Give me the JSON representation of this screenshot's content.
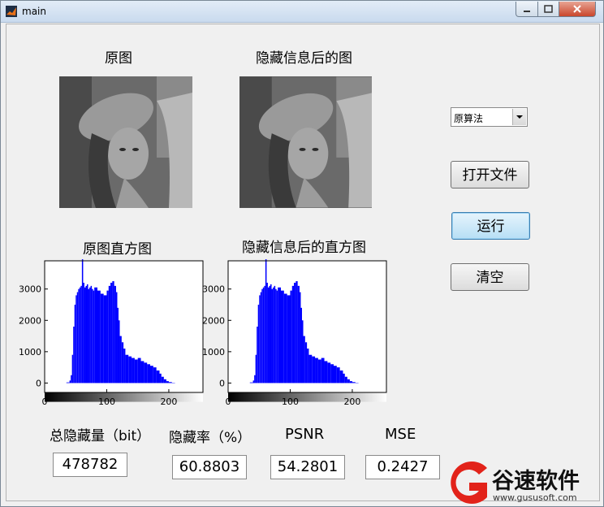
{
  "window": {
    "title": "main"
  },
  "labels": {
    "original_image": "原图",
    "stego_image": "隐藏信息后的图",
    "original_hist": "原图直方图",
    "stego_hist": "隐藏信息后的直方图",
    "capacity": "总隐藏量（bit）",
    "rate": "隐藏率（%）",
    "psnr": "PSNR",
    "mse": "MSE"
  },
  "values": {
    "capacity": "478782",
    "rate": "60.8803",
    "psnr": "54.2801",
    "mse": "0.2427"
  },
  "controls": {
    "algorithm_select": "原算法",
    "open_file_button": "打开文件",
    "run_button": "运行",
    "clear_button": "清空"
  },
  "colors": {
    "bars": "#0000ff",
    "active_button": "#b7dff5"
  },
  "watermark": {
    "name": "谷速软件",
    "url": "www.gususoft.com"
  },
  "chart_data": [
    {
      "type": "bar",
      "title": "原图直方图",
      "xlim": [
        0,
        255
      ],
      "ylim": [
        -300,
        3900
      ],
      "xticks": [
        "0",
        "100",
        "200"
      ],
      "yticks": [
        "0",
        "1000",
        "2000",
        "3000"
      ],
      "x": [
        30,
        35,
        40,
        42,
        44,
        46,
        48,
        50,
        52,
        54,
        56,
        58,
        60,
        62,
        64,
        66,
        68,
        70,
        72,
        74,
        76,
        78,
        80,
        85,
        90,
        95,
        100,
        103,
        106,
        109,
        112,
        115,
        117,
        119,
        121,
        124,
        127,
        130,
        135,
        140,
        145,
        150,
        155,
        160,
        165,
        170,
        175,
        180,
        185,
        188,
        192,
        196,
        200,
        205,
        210
      ],
      "values": [
        0,
        20,
        80,
        250,
        900,
        1800,
        2500,
        2800,
        2900,
        3000,
        3050,
        3100,
        3950,
        3200,
        3050,
        3100,
        3150,
        3000,
        3050,
        3100,
        3000,
        2950,
        3050,
        2950,
        2850,
        2800,
        2950,
        3100,
        3200,
        3250,
        3100,
        2900,
        2400,
        2000,
        1500,
        1300,
        1100,
        900,
        850,
        800,
        750,
        800,
        700,
        650,
        600,
        550,
        500,
        400,
        300,
        200,
        120,
        60,
        30,
        10,
        0
      ]
    },
    {
      "type": "bar",
      "title": "隐藏信息后的直方图",
      "xlim": [
        0,
        255
      ],
      "ylim": [
        -300,
        3900
      ],
      "xticks": [
        "0",
        "100",
        "200"
      ],
      "yticks": [
        "0",
        "1000",
        "2000",
        "3000"
      ],
      "x": [
        30,
        35,
        40,
        42,
        44,
        46,
        48,
        50,
        52,
        54,
        56,
        58,
        60,
        62,
        64,
        66,
        68,
        70,
        72,
        74,
        76,
        78,
        80,
        85,
        90,
        95,
        100,
        103,
        106,
        109,
        112,
        115,
        117,
        119,
        121,
        124,
        127,
        130,
        135,
        140,
        145,
        150,
        155,
        160,
        165,
        170,
        175,
        180,
        185,
        188,
        192,
        196,
        200,
        205,
        210
      ],
      "values": [
        0,
        20,
        80,
        250,
        900,
        1800,
        2500,
        2800,
        2900,
        3000,
        3050,
        3100,
        3950,
        3200,
        3050,
        3100,
        3150,
        3000,
        3050,
        3100,
        3000,
        2950,
        3050,
        2950,
        2850,
        2800,
        2950,
        3100,
        3200,
        3250,
        3100,
        2900,
        2400,
        2000,
        1500,
        1300,
        1100,
        900,
        850,
        800,
        750,
        800,
        700,
        650,
        600,
        550,
        500,
        400,
        300,
        200,
        120,
        60,
        30,
        10,
        0
      ]
    }
  ]
}
